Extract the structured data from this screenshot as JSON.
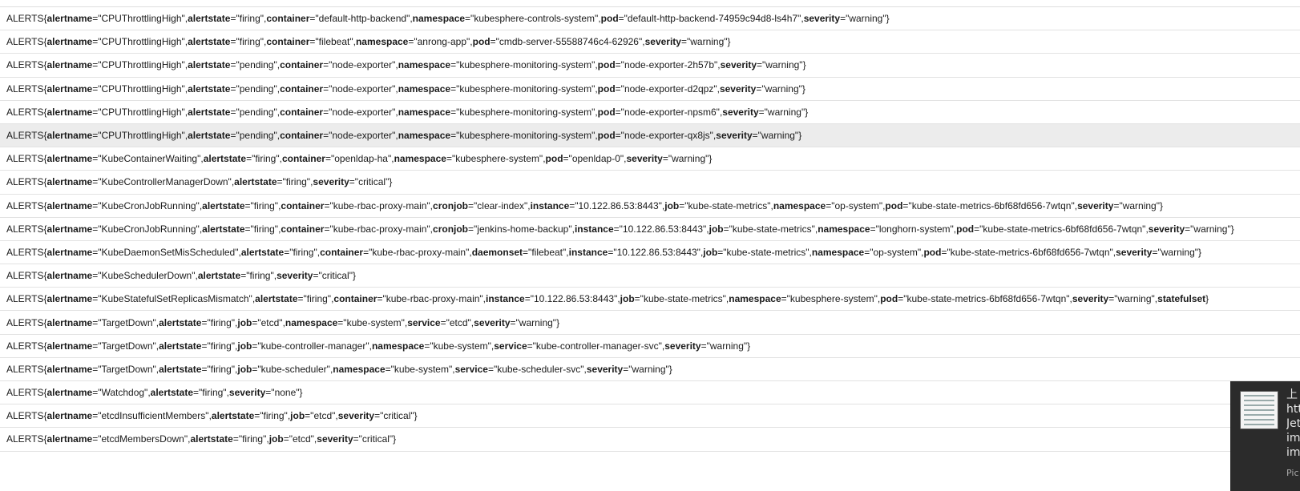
{
  "alerts": [
    {
      "alertname": "CPUThrottlingHigh",
      "alertstate": "firing",
      "container": "default-http-backend",
      "namespace": "kubesphere-controls-system",
      "pod": "default-http-backend-74959c94d8-ls4h7",
      "severity": "warning"
    },
    {
      "alertname": "CPUThrottlingHigh",
      "alertstate": "firing",
      "container": "filebeat",
      "namespace": "anrong-app",
      "pod": "cmdb-server-55588746c4-62926",
      "severity": "warning"
    },
    {
      "alertname": "CPUThrottlingHigh",
      "alertstate": "pending",
      "container": "node-exporter",
      "namespace": "kubesphere-monitoring-system",
      "pod": "node-exporter-2h57b",
      "severity": "warning"
    },
    {
      "alertname": "CPUThrottlingHigh",
      "alertstate": "pending",
      "container": "node-exporter",
      "namespace": "kubesphere-monitoring-system",
      "pod": "node-exporter-d2qpz",
      "severity": "warning"
    },
    {
      "alertname": "CPUThrottlingHigh",
      "alertstate": "pending",
      "container": "node-exporter",
      "namespace": "kubesphere-monitoring-system",
      "pod": "node-exporter-npsm6",
      "severity": "warning"
    },
    {
      "alertname": "CPUThrottlingHigh",
      "alertstate": "pending",
      "container": "node-exporter",
      "namespace": "kubesphere-monitoring-system",
      "pod": "node-exporter-qx8js",
      "severity": "warning",
      "highlighted": true
    },
    {
      "alertname": "KubeContainerWaiting",
      "alertstate": "firing",
      "container": "openldap-ha",
      "namespace": "kubesphere-system",
      "pod": "openldap-0",
      "severity": "warning"
    },
    {
      "alertname": "KubeControllerManagerDown",
      "alertstate": "firing",
      "severity": "critical"
    },
    {
      "alertname": "KubeCronJobRunning",
      "alertstate": "firing",
      "container": "kube-rbac-proxy-main",
      "cronjob": "clear-index",
      "instance": "10.122.86.53:8443",
      "job": "kube-state-metrics",
      "namespace": "op-system",
      "pod": "kube-state-metrics-6bf68fd656-7wtqn",
      "severity": "warning"
    },
    {
      "alertname": "KubeCronJobRunning",
      "alertstate": "firing",
      "container": "kube-rbac-proxy-main",
      "cronjob": "jenkins-home-backup",
      "instance": "10.122.86.53:8443",
      "job": "kube-state-metrics",
      "namespace": "longhorn-system",
      "pod": "kube-state-metrics-6bf68fd656-7wtqn",
      "severity": "warning"
    },
    {
      "alertname": "KubeDaemonSetMisScheduled",
      "alertstate": "firing",
      "container": "kube-rbac-proxy-main",
      "daemonset": "filebeat",
      "instance": "10.122.86.53:8443",
      "job": "kube-state-metrics",
      "namespace": "op-system",
      "pod": "kube-state-metrics-6bf68fd656-7wtqn",
      "severity": "warning"
    },
    {
      "alertname": "KubeSchedulerDown",
      "alertstate": "firing",
      "severity": "critical"
    },
    {
      "alertname": "KubeStatefulSetReplicasMismatch",
      "alertstate": "firing",
      "container": "kube-rbac-proxy-main",
      "instance": "10.122.86.53:8443",
      "job": "kube-state-metrics",
      "namespace": "kubesphere-system",
      "pod": "kube-state-metrics-6bf68fd656-7wtqn",
      "severity": "warning",
      "statefulset": ""
    },
    {
      "alertname": "TargetDown",
      "alertstate": "firing",
      "job": "etcd",
      "namespace": "kube-system",
      "service": "etcd",
      "severity": "warning"
    },
    {
      "alertname": "TargetDown",
      "alertstate": "firing",
      "job": "kube-controller-manager",
      "namespace": "kube-system",
      "service": "kube-controller-manager-svc",
      "severity": "warning"
    },
    {
      "alertname": "TargetDown",
      "alertstate": "firing",
      "job": "kube-scheduler",
      "namespace": "kube-system",
      "service": "kube-scheduler-svc",
      "severity": "warning"
    },
    {
      "alertname": "Watchdog",
      "alertstate": "firing",
      "severity": "none"
    },
    {
      "alertname": "etcdInsufficientMembers",
      "alertstate": "firing",
      "job": "etcd",
      "severity": "critical"
    },
    {
      "alertname": "etcdMembersDown",
      "alertstate": "firing",
      "job": "etcd",
      "severity": "critical"
    }
  ],
  "prefix": "ALERTS",
  "toast": {
    "lines": [
      "上",
      "htt",
      "Jet",
      "im",
      "im"
    ],
    "source": "Pic"
  }
}
